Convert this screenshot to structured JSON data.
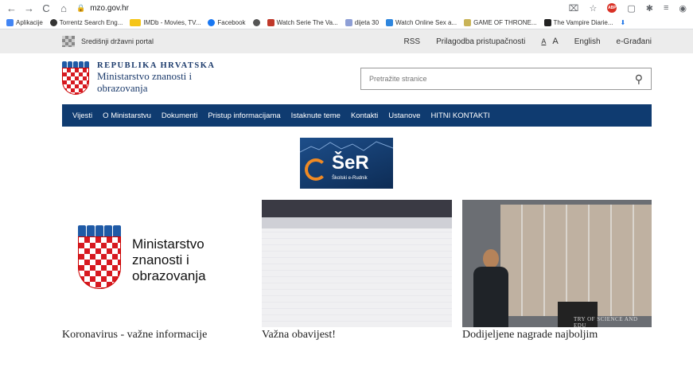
{
  "browser": {
    "url": "mzo.gov.hr",
    "bookmarks": [
      {
        "label": "Aplikacije",
        "color": "#4285f4"
      },
      {
        "label": "Torrentz Search Eng...",
        "color": "#333333"
      },
      {
        "label": "IMDb - Movies, TV...",
        "color": "#f5c518"
      },
      {
        "label": "Facebook",
        "color": "#1877f2"
      },
      {
        "label": "",
        "color": "#555555"
      },
      {
        "label": "Watch Serie The Va...",
        "color": "#c0392b"
      },
      {
        "label": "dijeta 30",
        "color": "#8e9fd6"
      },
      {
        "label": "Watch Online Sex a...",
        "color": "#2e86de"
      },
      {
        "label": "GAME OF THRONE...",
        "color": "#c9b458"
      },
      {
        "label": "The Vampire Diarie...",
        "color": "#222222"
      }
    ]
  },
  "portal": {
    "name": "Središnji državni portal",
    "links": [
      "RSS",
      "Prilagodba pristupačnosti",
      "A",
      "A",
      "English",
      "e-Građani"
    ]
  },
  "header": {
    "line1": "REPUBLIKA HRVATSKA",
    "line2": "Ministarstvo znanosti i",
    "line3": "obrazovanja",
    "search_placeholder": "Pretražite stranice"
  },
  "nav": [
    "Vijesti",
    "O Ministarstvu",
    "Dokumenti",
    "Pristup informacijama",
    "Istaknute teme",
    "Kontakti",
    "Ustanove",
    "HITNI KONTAKTI"
  ],
  "banner": {
    "title": "ŠeR",
    "subtitle": "Školski e-Rudnik"
  },
  "cards": [
    {
      "title": "Koronavirus - važne informacije",
      "logo_text": [
        "Ministarstvo",
        "znanosti i",
        "obrazovanja"
      ]
    },
    {
      "title": "Važna obavijest!"
    },
    {
      "title": "Dodijeljene nagrade najboljim",
      "band": "TRY OF SCIENCE AND EDU"
    }
  ]
}
